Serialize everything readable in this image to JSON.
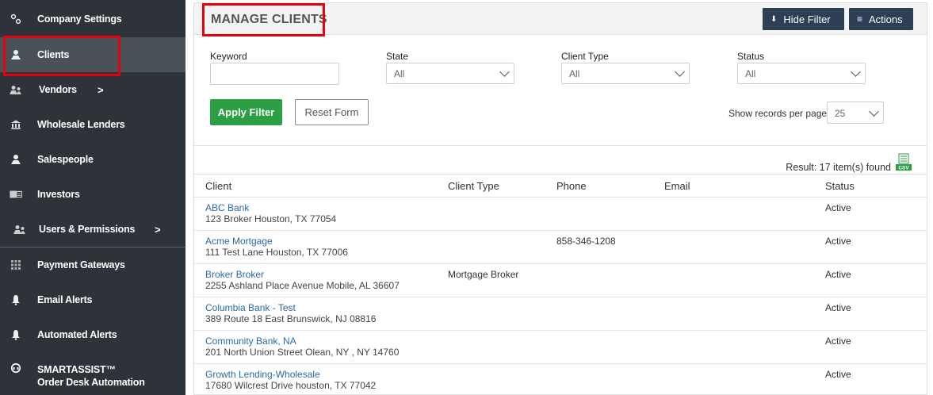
{
  "sidebar": {
    "items": [
      {
        "label": "Company Settings",
        "icon": "gears-icon"
      },
      {
        "label": "Clients",
        "icon": "user-icon"
      },
      {
        "label": "Vendors",
        "icon": "users-icon",
        "chevron": ">"
      },
      {
        "label": "Wholesale Lenders",
        "icon": "bank-icon"
      },
      {
        "label": "Salespeople",
        "icon": "user-icon"
      },
      {
        "label": "Investors",
        "icon": "id-card-icon"
      },
      {
        "label": "Users & Permissions",
        "icon": "users-icon",
        "chevron": ">"
      },
      {
        "label": "Payment Gateways",
        "icon": "grid-icon"
      },
      {
        "label": "Email Alerts",
        "icon": "bell-icon"
      },
      {
        "label": "Automated Alerts",
        "icon": "bell-icon"
      },
      {
        "label": "SMARTASSIST™",
        "label2": "Order Desk Automation",
        "icon": "headset-icon"
      }
    ],
    "active": "Clients"
  },
  "header": {
    "title": "MANAGE CLIENTS",
    "hide_filter_label": "Hide Filter",
    "actions_label": "Actions"
  },
  "filters": {
    "keyword_label": "Keyword",
    "keyword_value": "",
    "state_label": "State",
    "state_value": "All",
    "client_type_label": "Client Type",
    "client_type_value": "All",
    "status_label": "Status",
    "status_value": "All",
    "apply_label": "Apply Filter",
    "reset_label": "Reset Form",
    "records_per_page_label": "Show records per page",
    "records_per_page_value": "25"
  },
  "result_text": "Result: 17 item(s) found",
  "table": {
    "columns": [
      "Client",
      "Client Type",
      "Phone",
      "Email",
      "Status"
    ],
    "rows": [
      {
        "name": "ABC Bank",
        "address": "123 Broker Houston, TX 77054",
        "type": "",
        "phone": "",
        "email": "",
        "status": "Active"
      },
      {
        "name": "Acme Mortgage",
        "address": "111 Test Lane  Houston, TX 77006",
        "type": "",
        "phone": "858-346-1208",
        "email": "",
        "status": "Active"
      },
      {
        "name": "Broker Broker",
        "address": "2255 Ashland Place Avenue Mobile, AL 36607",
        "type": "Mortgage Broker",
        "phone": "",
        "email": "",
        "status": "Active"
      },
      {
        "name": "Columbia Bank - Test",
        "address": "389 Route 18 East Brunswick, NJ 08816",
        "type": "",
        "phone": "",
        "email": "",
        "status": "Active"
      },
      {
        "name": "Community Bank, NA",
        "address": "201 North Union Street Olean, NY , NY 14760",
        "type": "",
        "phone": "",
        "email": "",
        "status": "Active"
      },
      {
        "name": "Growth Lending-Wholesale",
        "address": "17680 Wilcrest Drive houston, TX 77042",
        "type": "",
        "phone": "",
        "email": "",
        "status": "Active"
      }
    ]
  },
  "colors": {
    "sidebar_bg": "#2d3339",
    "highlight": "#e3000f",
    "apply_green": "#2c9e44",
    "dark_button": "#2d3e55",
    "link": "#2b6aa8"
  }
}
